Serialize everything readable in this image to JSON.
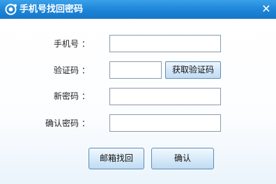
{
  "window": {
    "title": "手机号找回密码",
    "close_glyph": "✕",
    "title_bar_color": "#1c84d8"
  },
  "form": {
    "phone_label": "手机号 ：",
    "phone_value": "",
    "code_label": "验证码 ：",
    "code_value": "",
    "get_code_button": "获取验证码",
    "new_password_label": "新密码 ：",
    "new_password_value": "",
    "confirm_password_label": "确认密码 ：",
    "confirm_password_value": ""
  },
  "actions": {
    "email_recover_button": "邮箱找回",
    "confirm_button": "确认"
  },
  "icons": {
    "logo": "app-logo-icon",
    "close": "close-icon"
  }
}
